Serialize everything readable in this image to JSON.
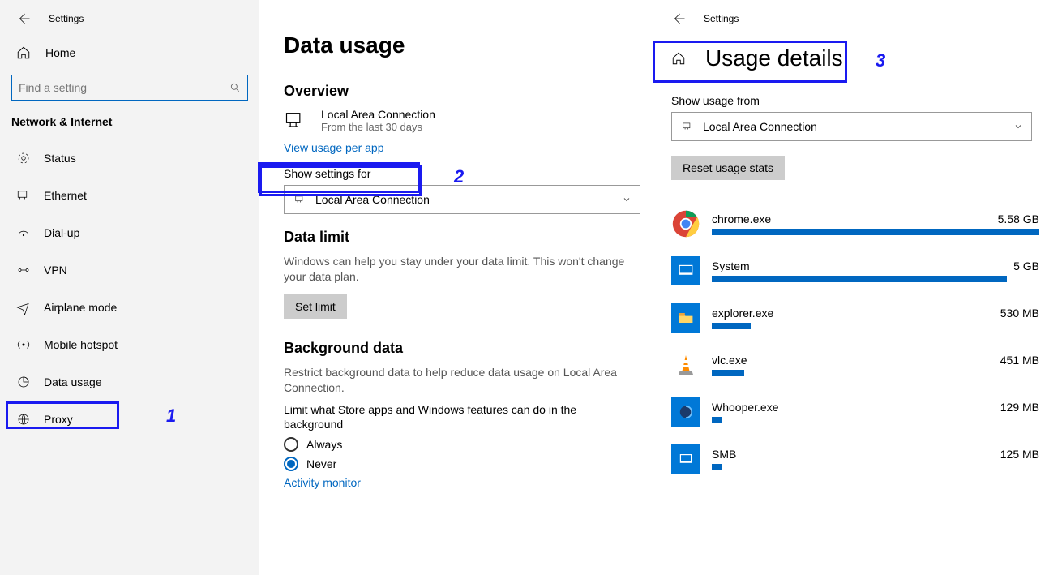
{
  "sidebar": {
    "header_title": "Settings",
    "home_label": "Home",
    "search_placeholder": "Find a setting",
    "category": "Network & Internet",
    "items": [
      {
        "label": "Status"
      },
      {
        "label": "Ethernet"
      },
      {
        "label": "Dial-up"
      },
      {
        "label": "VPN"
      },
      {
        "label": "Airplane mode"
      },
      {
        "label": "Mobile hotspot"
      },
      {
        "label": "Data usage"
      },
      {
        "label": "Proxy"
      }
    ]
  },
  "main": {
    "page_title": "Data usage",
    "overview_heading": "Overview",
    "connection_name": "Local Area Connection",
    "connection_sub": "From the last 30 days",
    "view_usage_link": "View usage per app",
    "show_settings_for_label": "Show settings for",
    "show_settings_value": "Local Area Connection",
    "data_limit_heading": "Data limit",
    "data_limit_desc": "Windows can help you stay under your data limit. This won't change your data plan.",
    "set_limit_button": "Set limit",
    "background_heading": "Background data",
    "background_desc": "Restrict background data to help reduce data usage on Local Area Connection.",
    "background_limit_text": "Limit what Store apps and Windows features can do in the background",
    "radio_always": "Always",
    "radio_never": "Never",
    "activity_link": "Activity monitor"
  },
  "right": {
    "header_title": "Settings",
    "page_title": "Usage details",
    "show_usage_label": "Show usage from",
    "show_usage_value": "Local Area Connection",
    "reset_button": "Reset usage stats",
    "apps": [
      {
        "name": "chrome.exe",
        "usage": "5.58 GB",
        "bar_pct": 100,
        "color": "#fff"
      },
      {
        "name": "System",
        "usage": "5 GB",
        "bar_pct": 90
      },
      {
        "name": "explorer.exe",
        "usage": "530 MB",
        "bar_pct": 12
      },
      {
        "name": "vlc.exe",
        "usage": "451 MB",
        "bar_pct": 10
      },
      {
        "name": "Whooper.exe",
        "usage": "129 MB",
        "bar_pct": 3
      },
      {
        "name": "SMB",
        "usage": "125 MB",
        "bar_pct": 3
      }
    ]
  },
  "annotations": {
    "n1": "1",
    "n2": "2",
    "n3": "3"
  }
}
